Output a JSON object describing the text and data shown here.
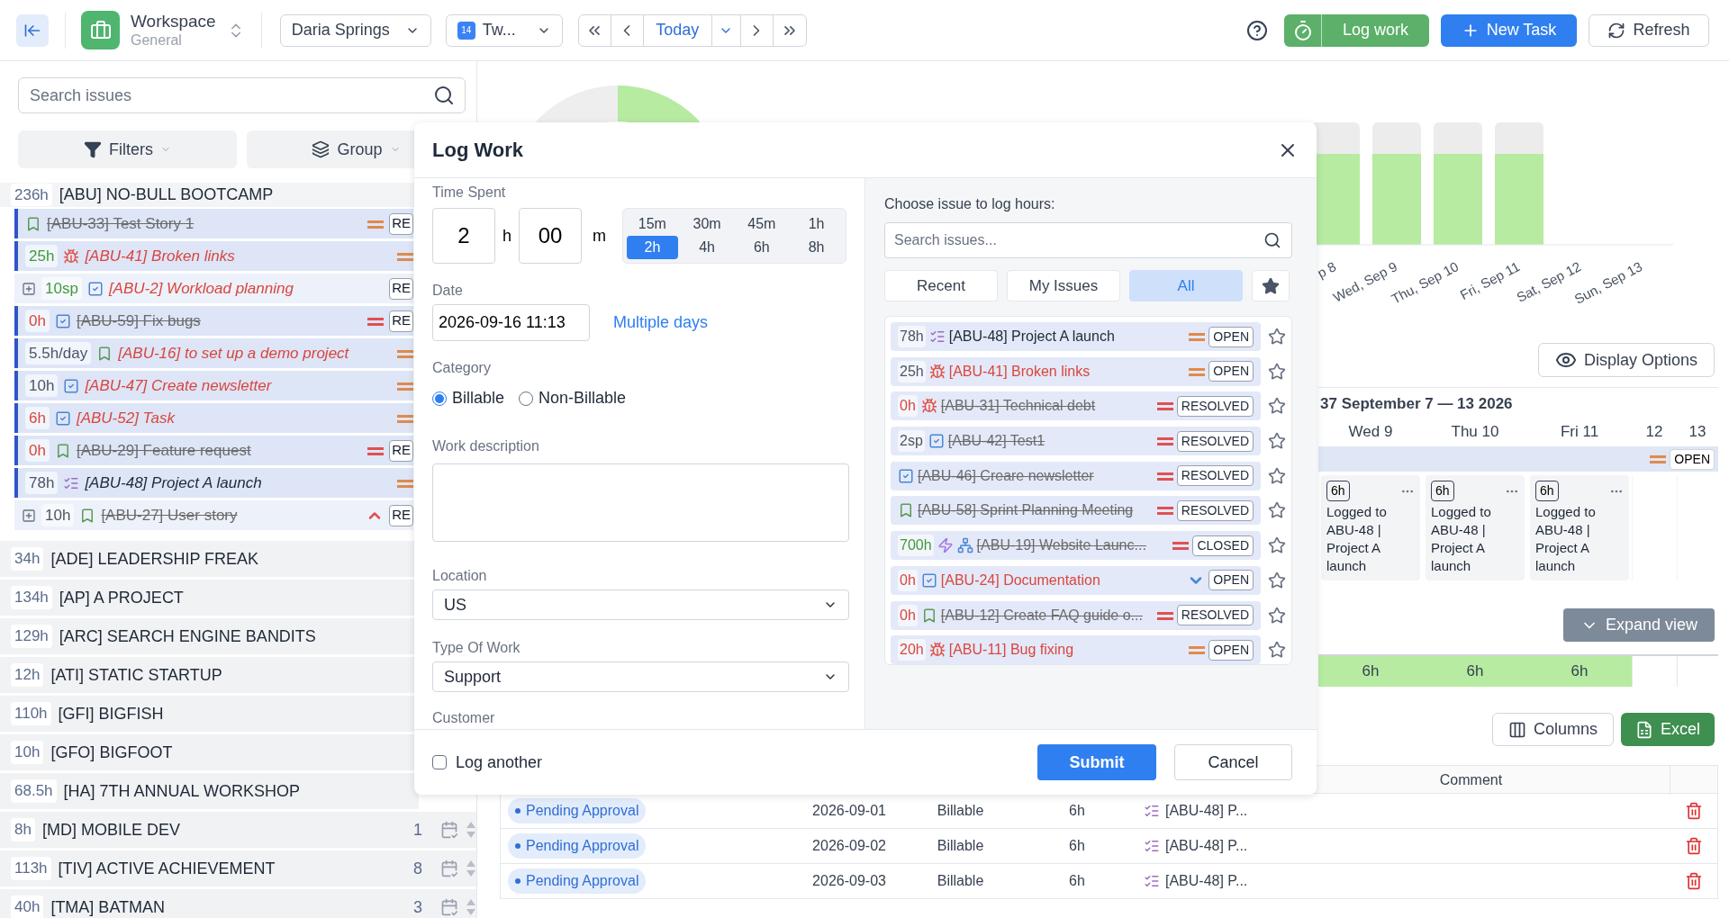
{
  "topbar": {
    "workspace": {
      "title": "Workspace",
      "subtitle": "General"
    },
    "user_select": "Daria Springs",
    "period_select": {
      "day": "14",
      "label": "Tw..."
    },
    "nav": {
      "today": "Today"
    },
    "log_work": "Log work",
    "new_task": "New Task",
    "refresh": "Refresh"
  },
  "sidebar": {
    "search_placeholder": "Search issues",
    "filters": "Filters",
    "group": "Group",
    "project": {
      "hours": "236h",
      "title": "[ABU] NO-BULL BOOTCAMP"
    },
    "issues": [
      {
        "kind": "story",
        "title": "[ABU-33] Test Story 1",
        "resolved": true,
        "overdue": false,
        "priority": {
          "kind": "equal",
          "color": "#e08a4b"
        },
        "status": "RE"
      },
      {
        "hours": {
          "text": "25h",
          "color": "#3f9a3a"
        },
        "kind": "bug",
        "title": "[ABU-41] Broken links",
        "resolved": false,
        "overdue": true,
        "priority": {
          "kind": "equal",
          "color": "#e08a4b"
        }
      },
      {
        "expanded": false,
        "hours": {
          "text": "10sp",
          "color": "#3f9a3a"
        },
        "kind": "task",
        "title": "[ABU-2] Workload planning",
        "resolved": false,
        "overdue": true,
        "status": "RE"
      },
      {
        "hours": {
          "text": "0h",
          "color": "#d9463e"
        },
        "kind": "task",
        "title": "[ABU-59] Fix bugs",
        "resolved": true,
        "overdue": false,
        "priority": {
          "kind": "equal",
          "color": "#e05050"
        },
        "status": "RE"
      },
      {
        "hours": {
          "text": "5.5h/day",
          "color": "#4b5563"
        },
        "kind": "story",
        "title": "[ABU-16] to set up a demo project",
        "resolved": false,
        "overdue": true,
        "priority": {
          "kind": "equal",
          "color": "#e08a4b"
        }
      },
      {
        "hours": {
          "text": "10h",
          "color": "#4b5563"
        },
        "kind": "task",
        "title": "[ABU-47] Create newsletter",
        "resolved": false,
        "overdue": true,
        "priority": {
          "kind": "equal",
          "color": "#e08a4b"
        }
      },
      {
        "hours": {
          "text": "6h",
          "color": "#d9463e"
        },
        "kind": "task",
        "title": "[ABU-52] Task",
        "resolved": false,
        "overdue": true,
        "priority": {
          "kind": "equal",
          "color": "#e08a4b"
        }
      },
      {
        "hours": {
          "text": "0h",
          "color": "#d9463e"
        },
        "kind": "story",
        "title": "[ABU-29] Feature request",
        "resolved": true,
        "overdue": false,
        "priority": {
          "kind": "equal",
          "color": "#e05050"
        },
        "status": "RE"
      },
      {
        "hours": {
          "text": "78h",
          "color": "#4b5563"
        },
        "kind": "checklist",
        "title": "[ABU-48] Project A launch",
        "resolved": false,
        "overdue": false,
        "priority": {
          "kind": "equal",
          "color": "#e08a4b"
        }
      },
      {
        "expanded": false,
        "hours": {
          "text": "10h",
          "color": "#4b5563"
        },
        "kind": "story",
        "title": "[ABU-27] User story",
        "resolved": true,
        "overdue": false,
        "priority": {
          "kind": "chevron_up",
          "color": "#e05050"
        },
        "status": "RE"
      }
    ],
    "projects": [
      {
        "hours": "34h",
        "title": "[ADE] LEADERSHIP FREAK"
      },
      {
        "hours": "134h",
        "title": "[AP] A PROJECT"
      },
      {
        "hours": "129h",
        "title": "[ARC] SEARCH ENGINE BANDITS"
      },
      {
        "hours": "12h",
        "title": "[ATI] STATIC STARTUP"
      },
      {
        "hours": "110h",
        "title": "[GFI] BIGFISH"
      },
      {
        "hours": "10h",
        "title": "[GFO] BIGFOOT"
      },
      {
        "hours": "68.5h",
        "title": "[HA] 7TH ANNUAL WORKSHOP"
      },
      {
        "hours": "8h",
        "title": "[MD] MOBILE DEV",
        "count": "1"
      },
      {
        "hours": "113h",
        "title": "[TIV] ACTIVE ACHIEVEMENT",
        "count": "8"
      },
      {
        "hours": "40h",
        "title": "[TMA] BATMAN",
        "count": "3"
      }
    ]
  },
  "chart": {
    "axis_labels": [
      "p 8",
      "Wed, Sep 9",
      "Thu, Sep 10",
      "Fri, Sep 11",
      "Sat, Sep 12",
      "Sun, Sep 13"
    ]
  },
  "display_options": "Display Options",
  "calendar": {
    "week_title": "37 September 7 — 13 2026",
    "row": {
      "priority": {
        "kind": "equal",
        "color": "#e08a4b"
      },
      "status": "OPEN"
    },
    "days": [
      {
        "label": "Wed 9",
        "entry": {
          "hours": "6h",
          "text": "Logged to ABU-48 | Project A launch"
        },
        "total": "6h"
      },
      {
        "label": "Thu 10",
        "entry": {
          "hours": "6h",
          "text": "Logged to ABU-48 | Project A launch"
        },
        "total": "6h"
      },
      {
        "label": "Fri 11",
        "entry": {
          "hours": "6h",
          "text": "Logged to ABU-48 | Project A launch"
        },
        "total": "6h"
      },
      {
        "label": "12"
      },
      {
        "label": "13"
      }
    ],
    "expand": "Expand view"
  },
  "table_tools": {
    "columns": "Columns",
    "excel": "Excel"
  },
  "table": {
    "comment_header": "Comment",
    "rows": [
      {
        "status": "Pending Approval",
        "date": "2026-09-01",
        "category": "Billable",
        "hours": "6h",
        "issue": "[ABU-48] P..."
      },
      {
        "status": "Pending Approval",
        "date": "2026-09-02",
        "category": "Billable",
        "hours": "6h",
        "issue": "[ABU-48] P..."
      },
      {
        "status": "Pending Approval",
        "date": "2026-09-03",
        "category": "Billable",
        "hours": "6h",
        "issue": "[ABU-48] P..."
      }
    ]
  },
  "modal": {
    "title": "Log Work",
    "time_spent": {
      "label": "Time Spent",
      "hours": "2",
      "hours_unit": "h",
      "minutes": "00",
      "minutes_unit": "m",
      "presets": [
        {
          "label": "15m",
          "selected": false
        },
        {
          "label": "30m",
          "selected": false
        },
        {
          "label": "45m",
          "selected": false
        },
        {
          "label": "1h",
          "selected": false
        },
        {
          "label": "2h",
          "selected": true
        },
        {
          "label": "4h",
          "selected": false
        },
        {
          "label": "6h",
          "selected": false
        },
        {
          "label": "8h",
          "selected": false
        }
      ]
    },
    "date": {
      "label": "Date",
      "value": "2026-09-16 11:13",
      "link": "Multiple days"
    },
    "category": {
      "label": "Category",
      "options": [
        {
          "label": "Billable",
          "selected": true
        },
        {
          "label": "Non-Billable",
          "selected": false
        }
      ]
    },
    "description": {
      "label": "Work description"
    },
    "location": {
      "label": "Location",
      "value": "US"
    },
    "type_of_work": {
      "label": "Type Of Work",
      "value": "Support"
    },
    "customer": {
      "label": "Customer"
    },
    "picker": {
      "label": "Choose issue to log hours:",
      "search_placeholder": "Search issues...",
      "tabs": [
        {
          "label": "Recent",
          "selected": false
        },
        {
          "label": "My Issues",
          "selected": false
        },
        {
          "label": "All",
          "selected": true
        }
      ],
      "issues": [
        {
          "hours": {
            "text": "78h",
            "color": "#4b5563"
          },
          "kind": "checklist",
          "title": "[ABU-48] Project A launch",
          "resolved": false,
          "overdue": false,
          "priority": {
            "kind": "equal",
            "color": "#e08a4b"
          },
          "status": "OPEN",
          "starred": false
        },
        {
          "hours": {
            "text": "25h",
            "color": "#4b5563"
          },
          "kind": "bug",
          "title": "[ABU-41] Broken links",
          "resolved": false,
          "overdue": true,
          "priority": {
            "kind": "equal",
            "color": "#e08a4b"
          },
          "status": "OPEN",
          "starred": false
        },
        {
          "hours": {
            "text": "0h",
            "color": "#d9463e"
          },
          "kind": "bug",
          "title": "[ABU-31] Technical debt",
          "resolved": true,
          "overdue": false,
          "priority": {
            "kind": "equal",
            "color": "#e05050"
          },
          "status": "RESOLVED",
          "starred": false
        },
        {
          "hours": {
            "text": "2sp",
            "color": "#4b5563"
          },
          "kind": "task",
          "title": "[ABU-42] Test1",
          "resolved": true,
          "overdue": false,
          "priority": {
            "kind": "equal",
            "color": "#e05050"
          },
          "status": "RESOLVED",
          "starred": false
        },
        {
          "kind": "task",
          "title": "[ABU-46] Creare newsletter",
          "resolved": true,
          "overdue": false,
          "priority": {
            "kind": "equal",
            "color": "#e05050"
          },
          "status": "RESOLVED",
          "starred": false
        },
        {
          "kind": "story",
          "title": "[ABU-58] Sprint Planning Meeting",
          "resolved": true,
          "overdue": false,
          "priority": {
            "kind": "equal",
            "color": "#e05050"
          },
          "status": "RESOLVED",
          "starred": false
        },
        {
          "hours": {
            "text": "700h",
            "color": "#3f9a3a"
          },
          "kind": "subtask",
          "title": "[ABU-19] Website Launc...",
          "resolved": true,
          "overdue": false,
          "priority": {
            "kind": "equal",
            "color": "#e05050"
          },
          "status": "CLOSED",
          "starred": false
        },
        {
          "hours": {
            "text": "0h",
            "color": "#d9463e"
          },
          "kind": "task",
          "title": "[ABU-24] Documentation",
          "resolved": false,
          "overdue": true,
          "priority": {
            "kind": "chevron_down",
            "color": "#4a86d6"
          },
          "status": "OPEN",
          "starred": false
        },
        {
          "hours": {
            "text": "0h",
            "color": "#d9463e"
          },
          "kind": "story",
          "title": "[ABU-12] Create FAQ guide o...",
          "resolved": true,
          "overdue": false,
          "priority": {
            "kind": "equal",
            "color": "#e05050"
          },
          "status": "RESOLVED",
          "starred": false
        },
        {
          "hours": {
            "text": "20h",
            "color": "#d9463e"
          },
          "kind": "bug",
          "title": "[ABU-11] Bug fixing",
          "resolved": false,
          "overdue": true,
          "priority": {
            "kind": "equal",
            "color": "#e08a4b"
          },
          "status": "OPEN",
          "starred": false
        }
      ]
    },
    "log_another": {
      "label": "Log another",
      "checked": false
    },
    "submit": "Submit",
    "cancel": "Cancel"
  }
}
